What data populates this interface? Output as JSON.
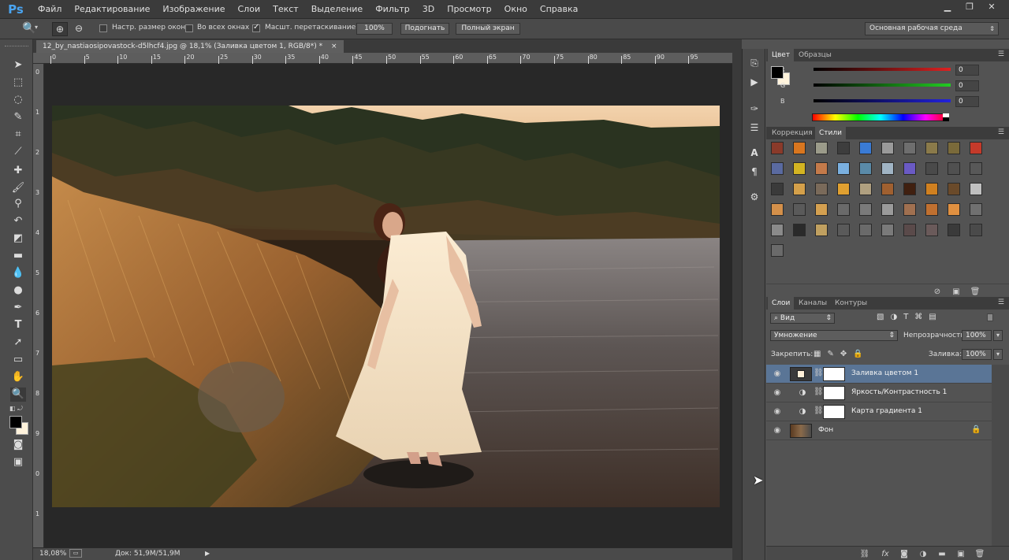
{
  "app": {
    "logo": "Ps"
  },
  "menu": [
    "Файл",
    "Редактирование",
    "Изображение",
    "Слои",
    "Текст",
    "Выделение",
    "Фильтр",
    "3D",
    "Просмотр",
    "Окно",
    "Справка"
  ],
  "options_bar": {
    "resize_windows": "Настр. размер окон",
    "all_windows": "Во всех окнах",
    "scrubby_zoom": "Масшт. перетаскиванием",
    "actual_pixels": "100%",
    "fit_screen": "Подогнать",
    "fill_screen": "Полный экран",
    "workspace": "Основная рабочая среда",
    "resize_windows_checked": false,
    "all_windows_checked": false,
    "scrubby_zoom_checked": true
  },
  "document": {
    "tab_title": "12_by_nastiaosipovastock-d5lhcf4.jpg @ 18,1% (Заливка цветом 1, RGB/8*) *",
    "close": "×"
  },
  "ruler": {
    "top_ticks": [
      "0",
      "5",
      "10",
      "15",
      "20",
      "25",
      "30",
      "35",
      "40",
      "45",
      "50",
      "55",
      "60",
      "65",
      "70",
      "75",
      "80",
      "85",
      "90",
      "95"
    ],
    "left_ticks": [
      "0",
      "1",
      "2",
      "3",
      "4",
      "5",
      "6",
      "7",
      "8",
      "9",
      "0",
      "1"
    ]
  },
  "status": {
    "zoom": "18,08%",
    "doc": "Док: 51,9M/51,9M"
  },
  "color_panel": {
    "tabs": [
      "Цвет",
      "Образцы"
    ],
    "channels": [
      {
        "label": "R",
        "value": "0",
        "color": "#d22"
      },
      {
        "label": "G",
        "value": "0",
        "color": "#2c2"
      },
      {
        "label": "B",
        "value": "0",
        "color": "#22d"
      }
    ]
  },
  "styles_panel": {
    "tabs": [
      "Коррекция",
      "Стили"
    ]
  },
  "layers_panel": {
    "tabs": [
      "Слои",
      "Каналы",
      "Контуры"
    ],
    "filter_kind": "Вид",
    "blend_mode": "Умножение",
    "opacity_label": "Непрозрачность:",
    "opacity": "100%",
    "lock_label": "Закрепить:",
    "fill_label": "Заливка:",
    "fill": "100%",
    "layers": [
      {
        "name": "Заливка цветом 1",
        "selected": true,
        "type": "fill",
        "color": "#fff0d8"
      },
      {
        "name": "Яркость/Контрастность 1",
        "selected": false,
        "type": "adjust"
      },
      {
        "name": "Карта градиента 1",
        "selected": false,
        "type": "adjust"
      },
      {
        "name": "Фон",
        "selected": false,
        "type": "background"
      }
    ]
  },
  "colors": {
    "accent": "#4aa4f0",
    "selected_layer": "#5a7596",
    "panel_bg": "#535353"
  }
}
